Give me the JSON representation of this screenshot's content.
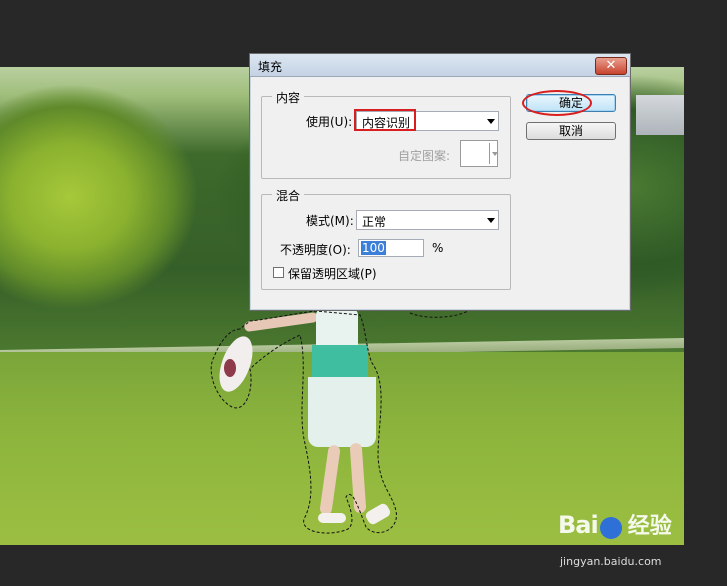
{
  "dialog": {
    "title": "填充",
    "close_label": "✕",
    "contents_group": {
      "title": "内容",
      "use_label": "使用(U):",
      "use_value": "内容识别",
      "custom_pattern_label": "自定图案:"
    },
    "blending_group": {
      "title": "混合",
      "mode_label": "模式(M):",
      "mode_value": "正常",
      "opacity_label": "不透明度(O):",
      "opacity_value": "100",
      "opacity_unit": "%",
      "preserve_transparency_label": "保留透明区域(P)",
      "preserve_transparency_checked": false
    },
    "ok_label": "确定",
    "cancel_label": "取消",
    "highlight_color": "#d81e1e"
  },
  "watermark": {
    "logo": "Bai",
    "logo_tail": "经验",
    "url": "jingyan.baidu.com"
  }
}
